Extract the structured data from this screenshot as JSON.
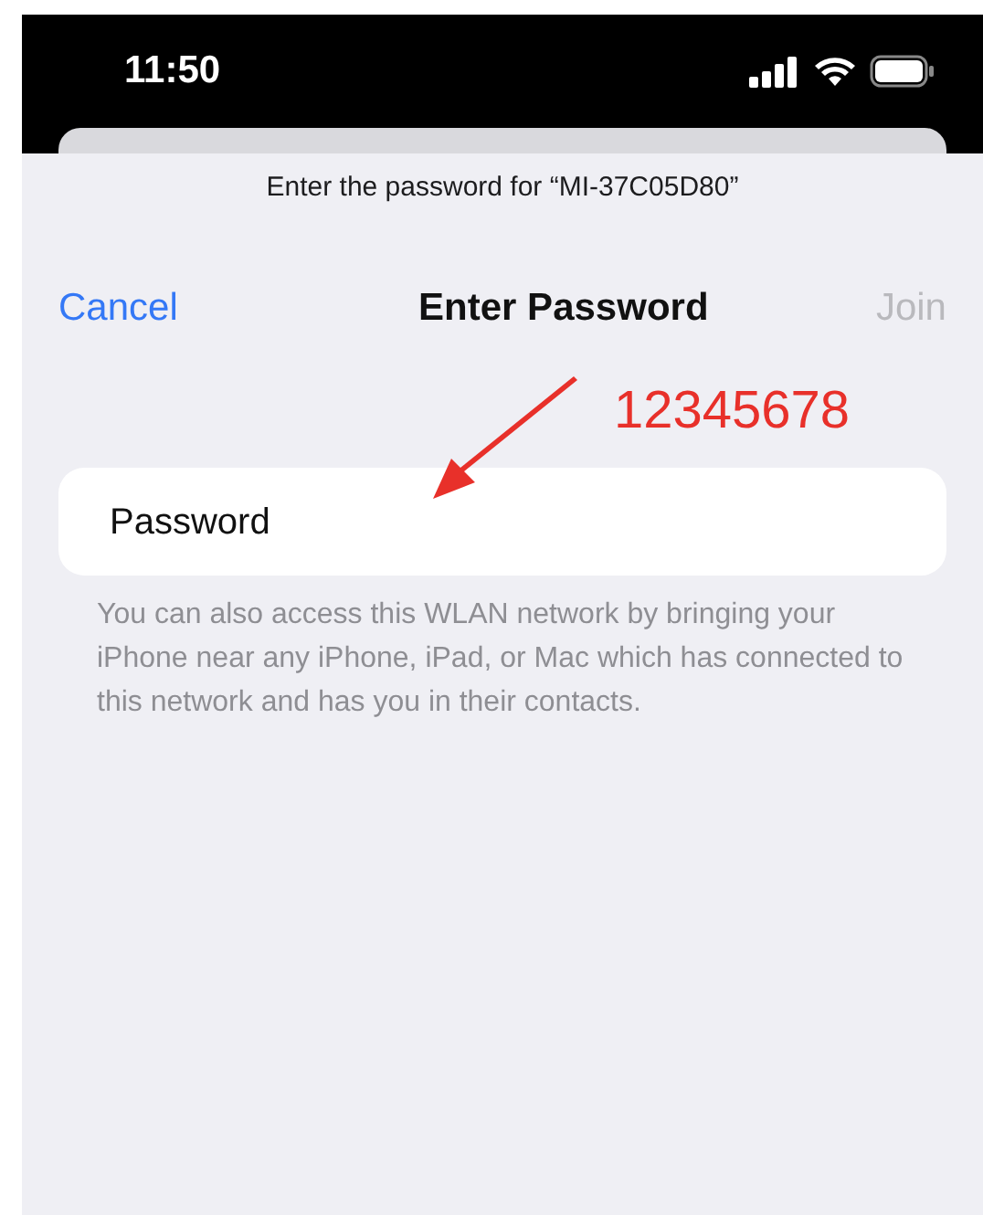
{
  "status_bar": {
    "time": "11:50"
  },
  "sheet": {
    "subtitle": "Enter the password for “MI-37C05D80”",
    "nav": {
      "cancel": "Cancel",
      "title": "Enter Password",
      "join": {
        "label": "Join",
        "disabled": true
      }
    },
    "password_field": {
      "label": "Password"
    },
    "footer": "You can also access this WLAN network by bringing your iPhone near any iPhone, iPad, or Mac which has connected to this network and has you in their contacts."
  },
  "annotation": {
    "text": "12345678"
  }
}
